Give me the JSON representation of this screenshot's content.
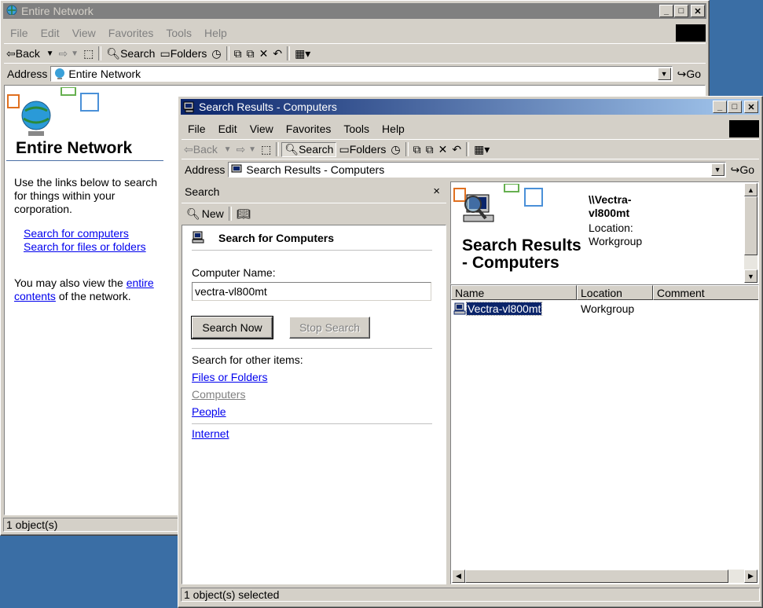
{
  "back_window": {
    "title": "Entire Network",
    "menu": [
      "File",
      "Edit",
      "View",
      "Favorites",
      "Tools",
      "Help"
    ],
    "toolbar": {
      "back": "Back",
      "search": "Search",
      "folders": "Folders"
    },
    "address_label": "Address",
    "address_value": "Entire Network",
    "go_label": "Go",
    "panel_title": "Entire Network",
    "intro_text": "Use the links below to search for things within your corporation.",
    "links": [
      "Search for computers",
      "Search for files or folders"
    ],
    "also_text_before": "You may also view the ",
    "also_link": "entire contents",
    "also_text_after": " of the network.",
    "status": "1 object(s)"
  },
  "front_window": {
    "title": "Search Results - Computers",
    "menu": [
      "File",
      "Edit",
      "View",
      "Favorites",
      "Tools",
      "Help"
    ],
    "toolbar": {
      "back": "Back",
      "search": "Search",
      "folders": "Folders"
    },
    "address_label": "Address",
    "address_value": "Search Results - Computers",
    "go_label": "Go",
    "search_pane": {
      "header": "Search",
      "close": "×",
      "new_label": "New",
      "heading": "Search for Computers",
      "field_label": "Computer Name:",
      "field_value": "vectra-vl800mt",
      "search_now": "Search Now",
      "stop_search": "Stop Search",
      "other_label": "Search for other items:",
      "other_links": [
        "Files or Folders",
        "Computers",
        "People"
      ],
      "internet_link": "Internet"
    },
    "results": {
      "banner_title": "Search Results - Computers",
      "detail_name": "\\\\Vectra-vl800mt",
      "detail_location": "Location: Workgroup",
      "columns": [
        "Name",
        "Location",
        "Comment"
      ],
      "rows": [
        {
          "name": "Vectra-vl800mt",
          "location": "Workgroup",
          "comment": ""
        }
      ]
    },
    "status": "1 object(s) selected"
  },
  "colors": {
    "desktop": "#3a6ea5",
    "active_title": "#0a246a",
    "inactive_title": "#808080",
    "face": "#d4d0c8",
    "selection": "#0a246a",
    "link": "#0000ee"
  }
}
